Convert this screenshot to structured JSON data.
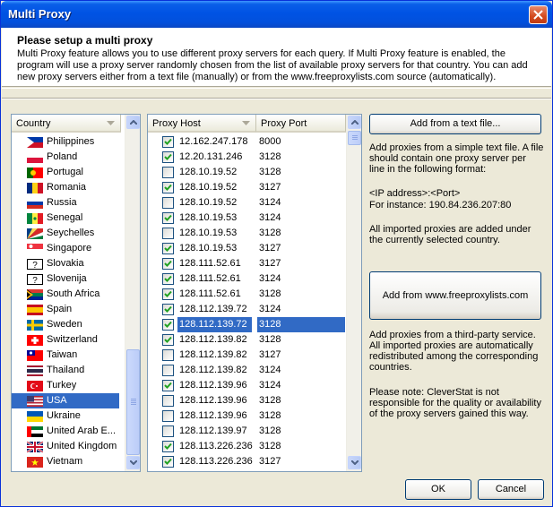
{
  "window": {
    "title": "Multi Proxy",
    "close_label": "close"
  },
  "header": {
    "title": "Please setup a multi proxy",
    "description": "Multi Proxy feature allows you to use different proxy servers for each query. If Multi Proxy feature is enabled, the program will use a proxy server randomly chosen from the list of available proxy servers for that country. You can add new proxy servers either from a text file (manually) or from the www.freeproxylists.com source (automatically)."
  },
  "countries": {
    "column_header": "Country",
    "items": [
      {
        "name": "Philippines",
        "flag": "philippines-flag",
        "selected": false
      },
      {
        "name": "Poland",
        "flag": "poland-flag",
        "selected": false
      },
      {
        "name": "Portugal",
        "flag": "portugal-flag",
        "selected": false
      },
      {
        "name": "Romania",
        "flag": "romania-flag",
        "selected": false
      },
      {
        "name": "Russia",
        "flag": "russia-flag",
        "selected": false
      },
      {
        "name": "Senegal",
        "flag": "senegal-flag",
        "selected": false
      },
      {
        "name": "Seychelles",
        "flag": "seychelles-flag",
        "selected": false
      },
      {
        "name": "Singapore",
        "flag": "singapore-flag",
        "selected": false
      },
      {
        "name": "Slovakia",
        "flag": "unknown-flag",
        "selected": false
      },
      {
        "name": "Slovenija",
        "flag": "unknown-flag",
        "selected": false
      },
      {
        "name": "South Africa",
        "flag": "south-africa-flag",
        "selected": false
      },
      {
        "name": "Spain",
        "flag": "spain-flag",
        "selected": false
      },
      {
        "name": "Sweden",
        "flag": "sweden-flag",
        "selected": false
      },
      {
        "name": "Switzerland",
        "flag": "switzerland-flag",
        "selected": false
      },
      {
        "name": "Taiwan",
        "flag": "taiwan-flag",
        "selected": false
      },
      {
        "name": "Thailand",
        "flag": "thailand-flag",
        "selected": false
      },
      {
        "name": "Turkey",
        "flag": "turkey-flag",
        "selected": false
      },
      {
        "name": "USA",
        "flag": "usa-flag",
        "selected": true
      },
      {
        "name": "Ukraine",
        "flag": "ukraine-flag",
        "selected": false
      },
      {
        "name": "United Arab E...",
        "flag": "uae-flag",
        "selected": false
      },
      {
        "name": "United Kingdom",
        "flag": "uk-flag",
        "selected": false
      },
      {
        "name": "Vietnam",
        "flag": "vietnam-flag",
        "selected": false
      }
    ]
  },
  "proxies": {
    "host_header": "Proxy Host",
    "port_header": "Proxy Port",
    "items": [
      {
        "host": "12.162.247.178",
        "port": "8000",
        "checked": true,
        "selected": false
      },
      {
        "host": "12.20.131.246",
        "port": "3128",
        "checked": true,
        "selected": false
      },
      {
        "host": "128.10.19.52",
        "port": "3128",
        "checked": false,
        "selected": false
      },
      {
        "host": "128.10.19.52",
        "port": "3127",
        "checked": true,
        "selected": false
      },
      {
        "host": "128.10.19.52",
        "port": "3124",
        "checked": false,
        "selected": false
      },
      {
        "host": "128.10.19.53",
        "port": "3124",
        "checked": true,
        "selected": false
      },
      {
        "host": "128.10.19.53",
        "port": "3128",
        "checked": false,
        "selected": false
      },
      {
        "host": "128.10.19.53",
        "port": "3127",
        "checked": true,
        "selected": false
      },
      {
        "host": "128.111.52.61",
        "port": "3127",
        "checked": true,
        "selected": false
      },
      {
        "host": "128.111.52.61",
        "port": "3124",
        "checked": true,
        "selected": false
      },
      {
        "host": "128.111.52.61",
        "port": "3128",
        "checked": true,
        "selected": false
      },
      {
        "host": "128.112.139.72",
        "port": "3124",
        "checked": true,
        "selected": false
      },
      {
        "host": "128.112.139.72",
        "port": "3128",
        "checked": true,
        "selected": true
      },
      {
        "host": "128.112.139.82",
        "port": "3128",
        "checked": true,
        "selected": false
      },
      {
        "host": "128.112.139.82",
        "port": "3127",
        "checked": false,
        "selected": false
      },
      {
        "host": "128.112.139.82",
        "port": "3124",
        "checked": false,
        "selected": false
      },
      {
        "host": "128.112.139.96",
        "port": "3124",
        "checked": true,
        "selected": false
      },
      {
        "host": "128.112.139.96",
        "port": "3128",
        "checked": false,
        "selected": false
      },
      {
        "host": "128.112.139.96",
        "port": "3128",
        "checked": false,
        "selected": false
      },
      {
        "host": "128.112.139.97",
        "port": "3128",
        "checked": false,
        "selected": false
      },
      {
        "host": "128.113.226.236",
        "port": "3128",
        "checked": true,
        "selected": false
      },
      {
        "host": "128.113.226.236",
        "port": "3127",
        "checked": true,
        "selected": false
      }
    ]
  },
  "side": {
    "add_text_file_label": "Add from a text file...",
    "text_file_desc": "Add proxies from a simple text file. A file should contain one proxy server per line in the following format:",
    "format_line": "<IP address>:<Port>",
    "instance_line": "For instance: 190.84.236.207:80",
    "imported_note": "All imported proxies are added under the currently selected country.",
    "add_freeproxy_label": "Add from www.freeproxylists.com",
    "third_party_desc": "Add proxies from a third-party service. All imported proxies are automatically redistributed among the corresponding countries.",
    "disclaimer": "Please note: CleverStat is not responsible for the quality or availability of the proxy servers gained this way."
  },
  "footer": {
    "ok_label": "OK",
    "cancel_label": "Cancel"
  }
}
